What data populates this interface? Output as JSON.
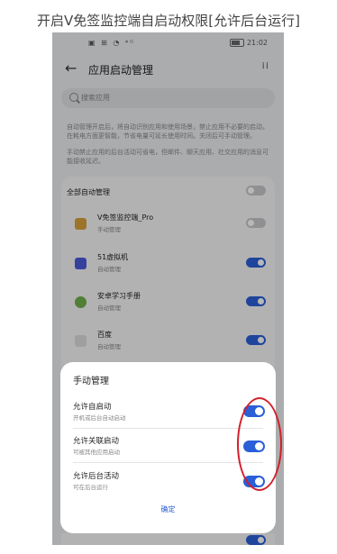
{
  "caption": "开启V免签监控端自启动权限[允许后台运行]",
  "statusbar": {
    "icons": "▣ ⊞ ◔ ⁴ᴳ",
    "time": "21:02"
  },
  "header": {
    "back_icon": "back-arrow-icon",
    "title": "应用启动管理",
    "more_icon": "more-icon"
  },
  "search": {
    "placeholder": "搜索应用"
  },
  "description": [
    "自动管理开启后，将自动识别应用和使用场景，禁止应用不必要的启动，在耗电方面更智能，节省电量可延长使用时间。关闭后可手动管理。",
    "手动禁止应用的后台活动可省电，但邮件、聊天应用、社交应用的消息可能接收延迟。"
  ],
  "all_auto": {
    "label": "全部自动管理",
    "toggle": "off"
  },
  "apps": [
    {
      "name": "V免签监控端_Pro",
      "sub": "手动管理",
      "toggle": "off",
      "icon_color": "#d9a13b"
    },
    {
      "name": "51虚拟机",
      "sub": "自动管理",
      "toggle": "on",
      "icon_color": "#4b5bdc"
    },
    {
      "name": "安卓学习手册",
      "sub": "自动管理",
      "toggle": "on",
      "icon_color": "#6fb04a"
    },
    {
      "name": "百度",
      "sub": "自动管理",
      "toggle": "on",
      "icon_color": "#dddddd"
    }
  ],
  "sheet": {
    "title": "手动管理",
    "options": [
      {
        "name": "允许自启动",
        "desc": "开机或后台自动启动",
        "toggle": "on"
      },
      {
        "name": "允许关联启动",
        "desc": "可被其他应用启动",
        "toggle": "on"
      },
      {
        "name": "允许后台活动",
        "desc": "可在后台运行",
        "toggle": "on"
      }
    ],
    "confirm": "确定"
  },
  "accent": "#2a5fd8",
  "highlight": "#d21f2a"
}
